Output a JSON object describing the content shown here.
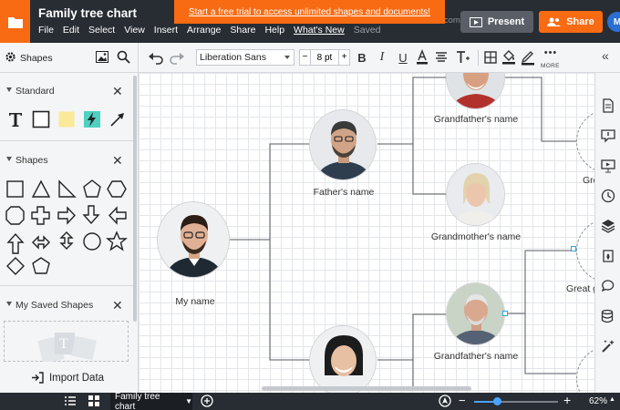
{
  "app": {
    "document_title": "Family tree chart",
    "menu": [
      "File",
      "Edit",
      "Select",
      "View",
      "Insert",
      "Arrange",
      "Share",
      "Help",
      "What's New",
      "Saved"
    ],
    "promo_text": "Start a free trial to access unlimited shapes and documents!",
    "promo_under_text": "Cuscom Field",
    "present_label": "Present",
    "share_label": "Share",
    "user_initial": "M"
  },
  "left_panel": {
    "title": "Shapes",
    "sections": {
      "standard": "Standard",
      "shapes": "Shapes",
      "saved": "My Saved Shapes"
    },
    "import_label": "Import Data"
  },
  "toolbar": {
    "font_family": "Liberation Sans",
    "font_size": "8 pt",
    "size_minus": "−",
    "size_plus": "+",
    "more_label": "MORE"
  },
  "tree": {
    "me": "My name",
    "father": "Father's name",
    "grandfather": "Grandfather's name",
    "grandmother": "Grandmother's name",
    "mother_side_grandfather": "Grandfather's name",
    "great1": "Great g",
    "great2": "Great g"
  },
  "bottom": {
    "page_tab": "Family tree chart",
    "zoom": "62%",
    "zoom_fraction": 0.28
  },
  "colors": {
    "topbar": "#282c33",
    "accent": "#f96b13",
    "canvas_grid": "#e4e6e9",
    "selection": "#2aa6e0"
  }
}
